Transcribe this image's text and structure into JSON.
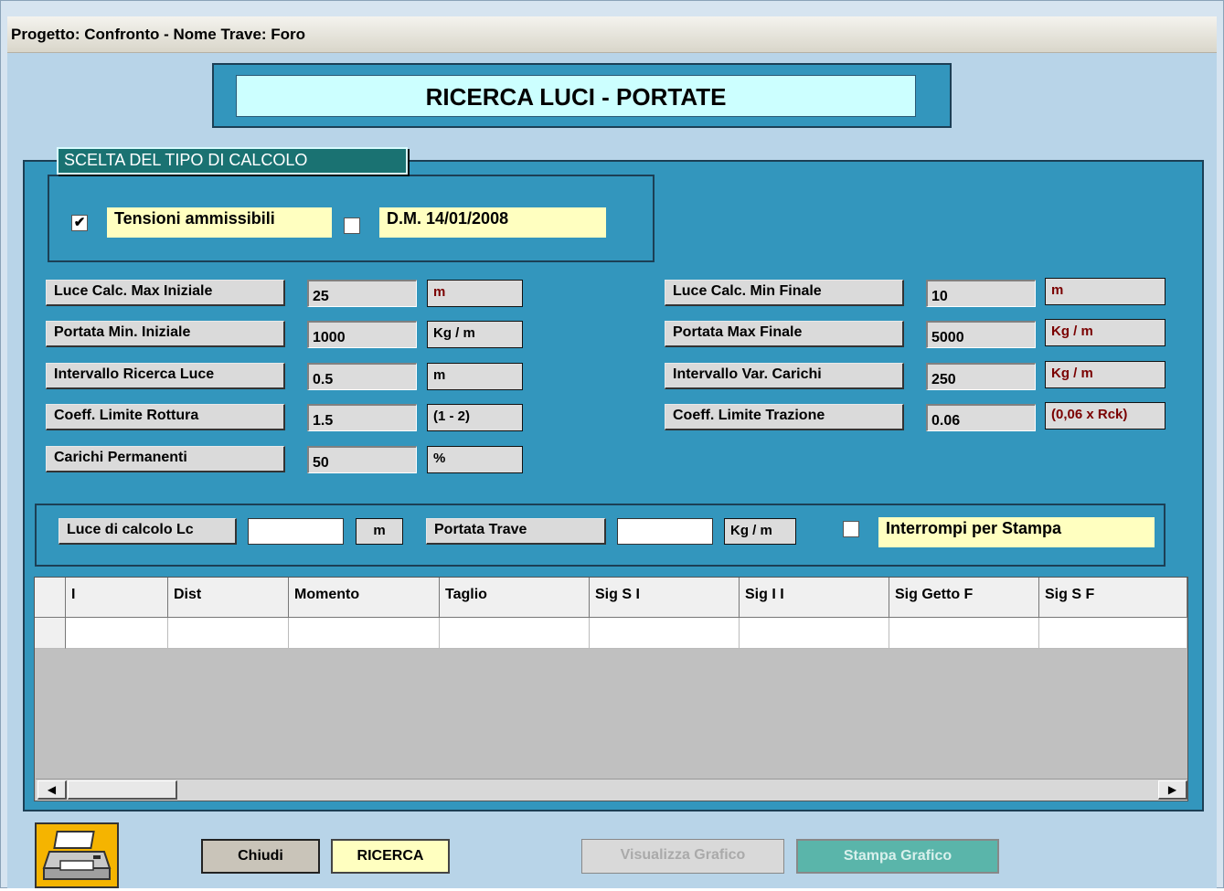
{
  "window": {
    "title": "Progetto: Confronto - Nome Trave: Foro"
  },
  "header": {
    "title": "RICERCA LUCI - PORTATE"
  },
  "calc_type": {
    "group_label": "SCELTA DEL TIPO DI CALCOLO",
    "options": [
      {
        "label": "Tensioni ammissibili",
        "checked": true
      },
      {
        "label": "D.M. 14/01/2008",
        "checked": false
      }
    ]
  },
  "params_left": [
    {
      "label": "Luce Calc. Max Iniziale",
      "value": "25",
      "unit": "m"
    },
    {
      "label": "Portata Min. Iniziale",
      "value": "1000",
      "unit": "Kg / m"
    },
    {
      "label": "Intervallo Ricerca Luce",
      "value": "0.5",
      "unit": "m"
    },
    {
      "label": "Coeff. Limite Rottura",
      "value": "1.5",
      "unit": "(1 - 2)"
    },
    {
      "label": "Carichi Permanenti",
      "value": "50",
      "unit": "%"
    }
  ],
  "params_right": [
    {
      "label": "Luce Calc. Min Finale",
      "value": "10",
      "unit": "m"
    },
    {
      "label": "Portata Max Finale",
      "value": "5000",
      "unit": "Kg / m"
    },
    {
      "label": "Intervallo Var. Carichi",
      "value": "250",
      "unit": "Kg / m"
    },
    {
      "label": "Coeff. Limite Trazione",
      "value": "0.06",
      "unit": "(0,06 x Rck)"
    }
  ],
  "luce_bar": {
    "lc_label": "Luce di calcolo  Lc",
    "lc_value": "",
    "lc_unit": "m",
    "portata_label": "Portata Trave",
    "portata_value": "",
    "portata_unit": "Kg / m",
    "interrompi_label": "Interrompi per Stampa",
    "interrompi_checked": false
  },
  "grid": {
    "columns": [
      "I",
      "Dist",
      "Momento",
      "Taglio",
      "Sig S I",
      "Sig I I",
      "Sig Getto F",
      "Sig S F"
    ],
    "rows": [
      [
        "",
        "",
        "",
        "",
        "",
        "",
        "",
        ""
      ]
    ]
  },
  "buttons": {
    "print_icon": "printer-icon",
    "chiudi": "Chiudi",
    "ricerca": "RICERCA",
    "visualizza": "Visualizza Grafico",
    "stampa": "Stampa Grafico"
  },
  "colors": {
    "panel": "#3396bd",
    "header_title_bg": "#ccffff",
    "highlight_yellow": "#ffffc0",
    "group_tag": "#1a7272"
  }
}
